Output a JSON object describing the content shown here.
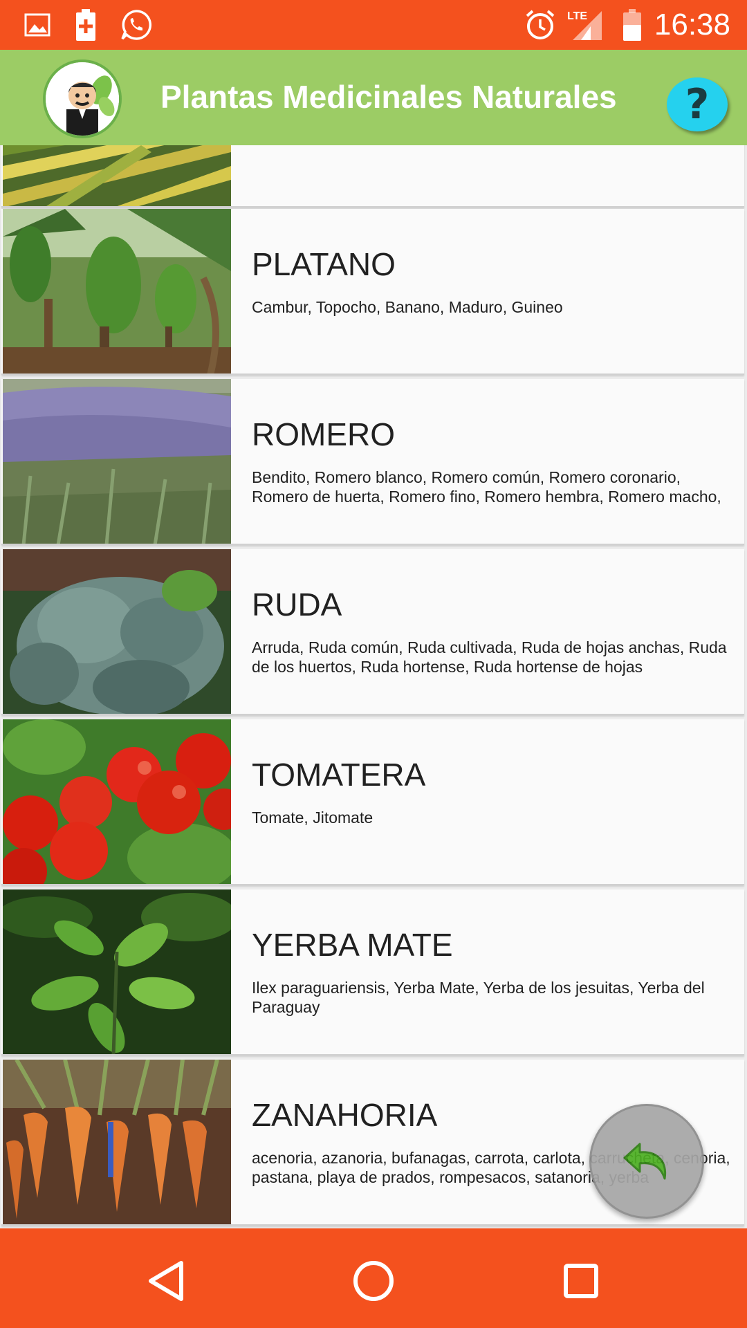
{
  "status_bar": {
    "time": "16:38",
    "network": "LTE",
    "icons": [
      "image-icon",
      "battery-plus-icon",
      "whatsapp-icon",
      "alarm-icon",
      "signal-icon",
      "battery-icon"
    ]
  },
  "app_bar": {
    "title": "Plantas Medicinales Naturales",
    "help_label": "?"
  },
  "plants": [
    {
      "name": "",
      "desc": "",
      "image_icon": "yucca-leaves-image"
    },
    {
      "name": "PLATANO",
      "desc": "Cambur, Topocho, Banano, Maduro, Guineo",
      "image_icon": "banana-tree-image"
    },
    {
      "name": "ROMERO",
      "desc": "Bendito, Romero blanco, Romero común, Romero coronario, Romero de huerta, Romero fino, Romero hembra, Romero macho,",
      "image_icon": "rosemary-bush-image"
    },
    {
      "name": "RUDA",
      "desc": "Arruda, Ruda común, Ruda cultivada, Ruda de hojas anchas, Ruda de los huertos, Ruda hortense, Ruda hortense de hojas",
      "image_icon": "rue-plant-image"
    },
    {
      "name": "TOMATERA",
      "desc": "Tomate, Jitomate",
      "image_icon": "tomato-plant-image"
    },
    {
      "name": "YERBA MATE",
      "desc": "Ilex paraguariensis, Yerba Mate, Yerba de los jesuitas, Yerba del Paraguay",
      "image_icon": "yerba-mate-leaves-image"
    },
    {
      "name": "ZANAHORIA",
      "desc": "acenoria, azanoria, bufanagas, carrota, carlota, carrucheta, cenoria, pastana, playa de prados, rompesacos, satanoria, yerba",
      "image_icon": "carrots-image"
    }
  ],
  "colors": {
    "status_bar": "#f4511e",
    "app_bar": "#9ccc65",
    "nav_bar": "#f4511e",
    "help_button": "#25d1ee",
    "card_bg": "#fafafa"
  },
  "fab": {
    "icon": "undo-arrow-icon"
  },
  "nav": {
    "icons": [
      "back-triangle-icon",
      "home-circle-icon",
      "recents-square-icon"
    ]
  }
}
